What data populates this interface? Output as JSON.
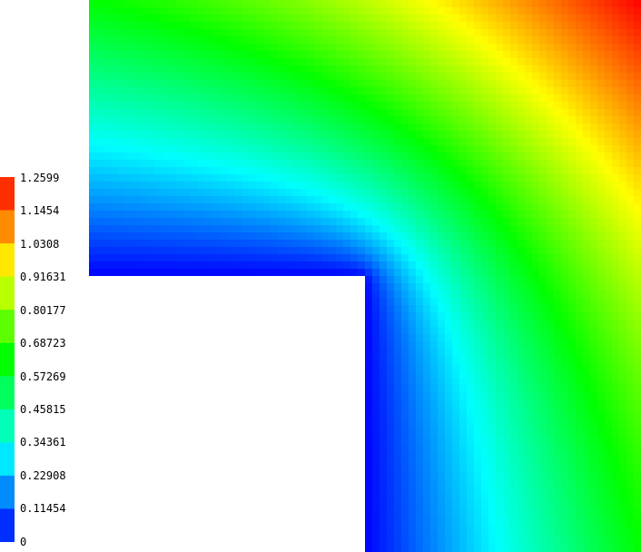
{
  "chart_data": {
    "type": "heatmap",
    "title": "",
    "xlabel": "",
    "ylabel": "",
    "description_domain": "L-shaped domain contour fill",
    "value_range": [
      0,
      1.2599
    ],
    "colormap": [
      "#0000ff",
      "#00ffff",
      "#00ff00",
      "#ffff00",
      "#ff0000"
    ],
    "colorbar": {
      "placement": "left",
      "ticks": [
        "1.2599",
        "1.1454",
        "1.0308",
        "0.91631",
        "0.80177",
        "0.68723",
        "0.57269",
        "0.45815",
        "0.34361",
        "0.22908",
        "0.11454",
        "0"
      ]
    }
  }
}
